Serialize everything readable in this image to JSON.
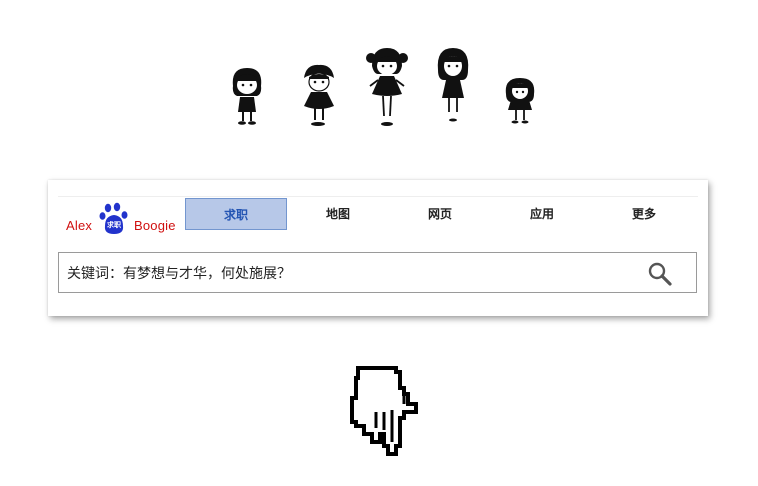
{
  "logo": {
    "left_text": "Alex",
    "right_text": "Boogie",
    "badge_text": "求职",
    "brand_red": "#d01010",
    "paw_blue": "#2233cc"
  },
  "tabs": [
    {
      "label": "求职",
      "active": true
    },
    {
      "label": "地图",
      "active": false
    },
    {
      "label": "网页",
      "active": false
    },
    {
      "label": "应用",
      "active": false
    },
    {
      "label": "更多",
      "active": false
    }
  ],
  "search": {
    "value": "关键词：有梦想与才华，何处施展？",
    "icon": "search-icon"
  },
  "decorations": {
    "doodle_count": 5,
    "pointer": "pointing-hand-icon"
  },
  "colors": {
    "active_tab_bg": "#b7c8e8",
    "active_tab_border": "#7396cf",
    "active_tab_text": "#2455b3"
  }
}
